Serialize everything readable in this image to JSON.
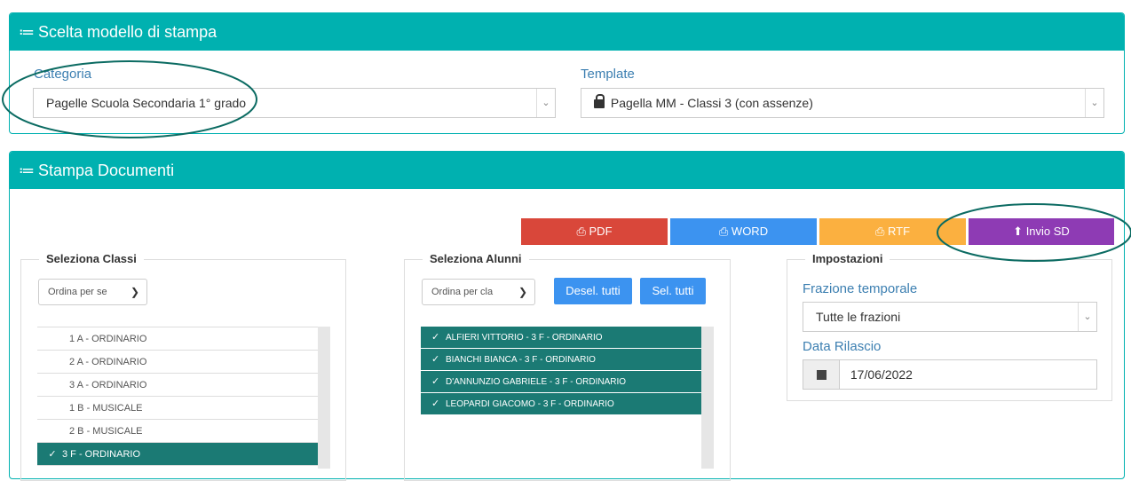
{
  "panel_model": {
    "title": "Scelta modello di stampa",
    "categoria_label": "Categoria",
    "categoria_value": "Pagelle Scuola Secondaria 1° grado",
    "template_label": "Template",
    "template_value": "Pagella MM - Classi 3 (con assenze)"
  },
  "panel_docs": {
    "title": "Stampa Documenti",
    "buttons": {
      "pdf": "PDF",
      "word": "WORD",
      "rtf": "RTF",
      "invio": "Invio SD"
    },
    "classi": {
      "legend": "Seleziona Classi",
      "order_select": "Ordina per se",
      "items": [
        "1 A - ORDINARIO",
        "2 A - ORDINARIO",
        "3 A - ORDINARIO",
        "1 B - MUSICALE",
        "2 B - MUSICALE",
        "3 F - ORDINARIO"
      ],
      "selected_check": "✓"
    },
    "alunni": {
      "legend": "Seleziona Alunni",
      "order_select": "Ordina per cla",
      "desel_label": "Desel. tutti",
      "sel_label": "Sel. tutti",
      "items": [
        "ALFIERI VITTORIO - 3 F - ORDINARIO",
        "BIANCHI BIANCA - 3 F - ORDINARIO",
        "D'ANNUNZIO GABRIELE - 3 F - ORDINARIO",
        "LEOPARDI GIACOMO - 3 F - ORDINARIO"
      ],
      "check": "✓"
    },
    "impostazioni": {
      "legend": "Impostazioni",
      "frazione_label": "Frazione temporale",
      "frazione_value": "Tutte le frazioni",
      "data_label": "Data Rilascio",
      "data_value": "17/06/2022"
    }
  },
  "colors": {
    "header": "#00b1b0",
    "pdf": "#d9473a",
    "word": "#3c93f0",
    "rtf": "#fbb040",
    "invio": "#8e3bb4",
    "selected_row": "#1b7a74",
    "annotation": "#0b6b62"
  },
  "icons": {
    "list": "list-icon",
    "lock": "lock-icon",
    "printer": "printer-icon",
    "upload": "upload-icon",
    "calendar": "calendar-icon",
    "chevron": "chevron-down-icon"
  }
}
